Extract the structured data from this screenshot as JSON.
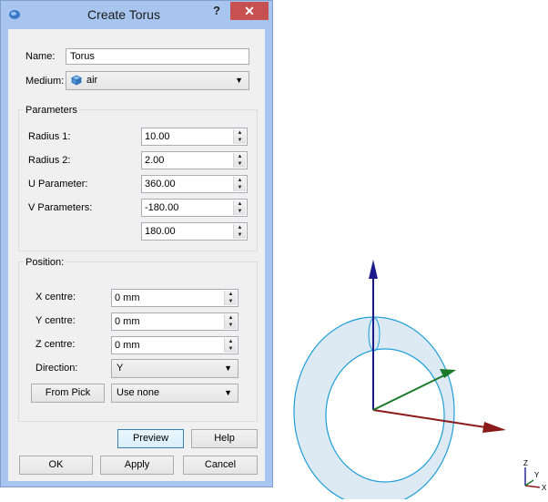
{
  "dialog": {
    "title": "Create Torus",
    "help_glyph": "?",
    "close_glyph": "✕",
    "name": {
      "label": "Name:",
      "value": "Torus"
    },
    "medium": {
      "label": "Medium:",
      "value": "air"
    },
    "parameters": {
      "title": "Parameters",
      "radius1": {
        "label": "Radius 1:",
        "value": "10.00"
      },
      "radius2": {
        "label": "Radius 2:",
        "value": "2.00"
      },
      "u_param": {
        "label": "U Parameter:",
        "value": "360.00"
      },
      "v_params": {
        "label": "V Parameters:",
        "value_min": "-180.00",
        "value_max": "180.00"
      }
    },
    "position": {
      "title": "Position:",
      "x_centre": {
        "label": "X centre:",
        "value": "0 mm"
      },
      "y_centre": {
        "label": "Y centre:",
        "value": "0 mm"
      },
      "z_centre": {
        "label": "Z centre:",
        "value": "0 mm"
      },
      "direction": {
        "label": "Direction:",
        "value": "Y"
      },
      "from_pick": {
        "label": "From Pick",
        "value": "Use none"
      }
    },
    "buttons": {
      "preview": "Preview",
      "help": "Help",
      "ok": "OK",
      "apply": "Apply",
      "cancel": "Cancel"
    }
  },
  "viewport": {
    "axis_triad": {
      "z_label": "Z",
      "x_label": "X",
      "y_label": "Y"
    }
  },
  "colors": {
    "title_bar": "#a7c5ee",
    "close_button": "#c75050",
    "torus_fill": "#dde9f3",
    "torus_edge": "#1e9fd8",
    "axis_up": "#1a1a8c",
    "axis_right": "#8b1a1a",
    "axis_diag": "#1a7a2a"
  }
}
